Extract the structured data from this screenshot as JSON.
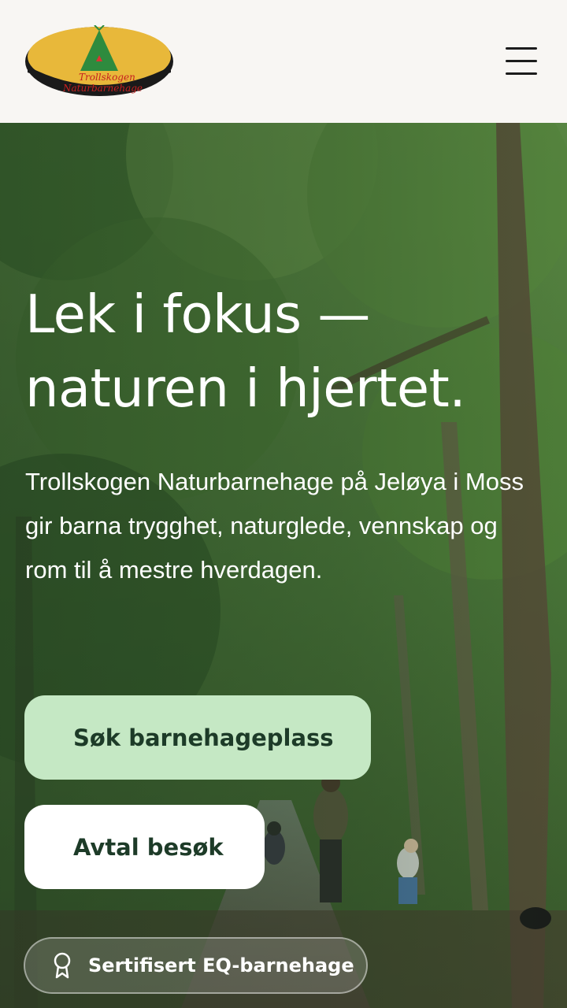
{
  "header": {
    "logo_text_line1": "Trollskogen",
    "logo_text_line2": "Naturbarnehage",
    "menu_icon": "hamburger-menu-icon"
  },
  "hero": {
    "headline_line1": "Lek i fokus —",
    "headline_line2": "naturen i hjertet.",
    "lead": "Trollskogen Naturbarnehage på Jeløya i Moss gir barna trygghet, naturglede, vennskap og rom til å mestre hverdagen.",
    "primary_button": "Søk barnehageplass",
    "secondary_button": "Avtal besøk",
    "badge": "Sertifisert EQ-barnehage",
    "badge_icon": "award-ribbon-icon"
  },
  "colors": {
    "primary_button_bg": "#c5e8c4",
    "button_text": "#1d3b28",
    "header_bg": "#f8f6f3"
  }
}
